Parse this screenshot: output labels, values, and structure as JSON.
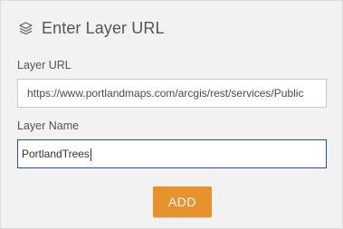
{
  "panel": {
    "title": "Enter Layer URL",
    "title_icon": "layers-icon"
  },
  "fields": {
    "url": {
      "label": "Layer URL",
      "value": "https://www.portlandmaps.com/arcgis/rest/services/Public"
    },
    "name": {
      "label": "Layer Name",
      "value": "PortlandTrees"
    }
  },
  "actions": {
    "add_label": "ADD"
  },
  "colors": {
    "accent": "#e8922d",
    "focus_border": "#1f4f8f",
    "panel_bg": "#f2f2f2"
  }
}
